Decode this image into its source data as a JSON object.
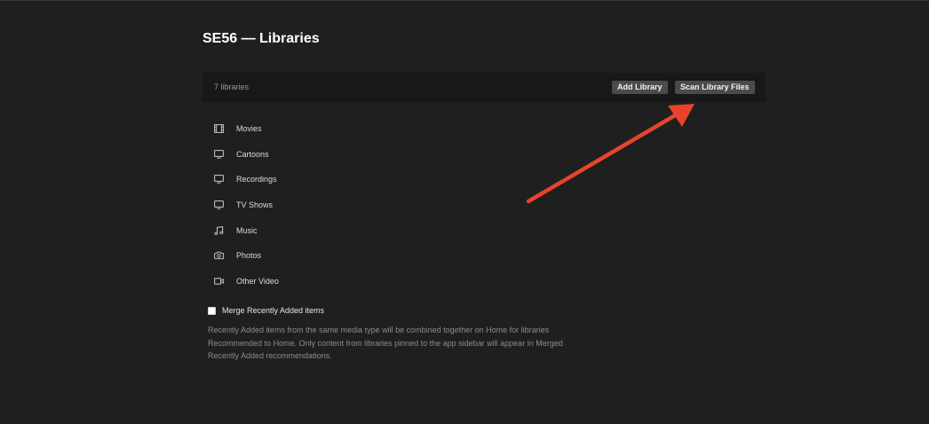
{
  "header": {
    "title": "SE56 — Libraries"
  },
  "toolbar": {
    "count_label": "7 libraries",
    "add_label": "Add Library",
    "scan_label": "Scan Library Files"
  },
  "libraries": [
    {
      "label": "Movies",
      "icon": "film-icon"
    },
    {
      "label": "Cartoons",
      "icon": "monitor-icon"
    },
    {
      "label": "Recordings",
      "icon": "monitor-icon"
    },
    {
      "label": "TV Shows",
      "icon": "monitor-icon"
    },
    {
      "label": "Music",
      "icon": "music-note-icon"
    },
    {
      "label": "Photos",
      "icon": "camera-icon"
    },
    {
      "label": "Other Video",
      "icon": "video-camera-icon"
    }
  ],
  "merge": {
    "label": "Merge Recently Added items",
    "checked": false,
    "description": "Recently Added items from the same media type will be combined together on Home for libraries Recommended to Home. Only content from libraries pinned to the app sidebar will appear in Merged Recently Added recommendations."
  },
  "colors": {
    "background": "#1f1f1f",
    "toolbar": "#181818",
    "button": "#4b4b4b",
    "annotation_arrow": "#e8432c"
  }
}
